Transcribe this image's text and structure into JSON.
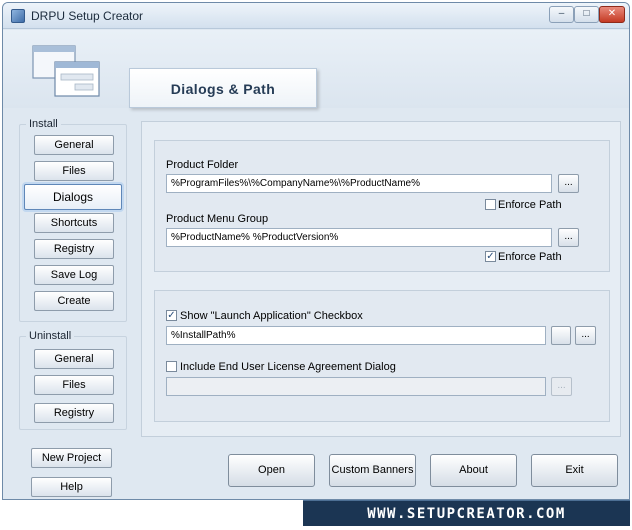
{
  "window": {
    "title": "DRPU Setup Creator",
    "controls": {
      "minimize": "–",
      "maximize": "□",
      "close": "✕"
    }
  },
  "header": {
    "title": "Dialogs & Path",
    "icon": "windows-stack-icon"
  },
  "sidebar": {
    "install_label": "Install",
    "install_items": [
      "General",
      "Files",
      "Dialogs",
      "Shortcuts",
      "Registry",
      "Save Log",
      "Create"
    ],
    "active_item": "Dialogs",
    "uninstall_label": "Uninstall",
    "uninstall_items": [
      "General",
      "Files",
      "Registry"
    ],
    "new_project": "New Project",
    "help": "Help"
  },
  "main": {
    "product_folder": {
      "label": "Product Folder",
      "value": "%ProgramFiles%\\%CompanyName%\\%ProductName%",
      "browse": "...",
      "enforce_label": "Enforce Path",
      "enforce_checked": false
    },
    "menu_group": {
      "label": "Product Menu Group",
      "value": "%ProductName% %ProductVersion%",
      "browse": "...",
      "enforce_label": "Enforce Path",
      "enforce_checked": true
    },
    "launch_app": {
      "label": "Show \"Launch Application\" Checkbox",
      "checked": true,
      "value": "%InstallPath%",
      "browse": "..."
    },
    "eula": {
      "label": "Include End User License Agreement Dialog",
      "checked": false,
      "value": "",
      "browse": "..."
    }
  },
  "actions": {
    "open": "Open",
    "custom_banners": "Custom Banners",
    "about": "About",
    "exit": "Exit"
  },
  "branding": {
    "url": "WWW.SETUPCREATOR.COM"
  },
  "colors": {
    "accent": "#1b3553",
    "panel": "#dfe8f1",
    "border": "#8e9cab"
  }
}
